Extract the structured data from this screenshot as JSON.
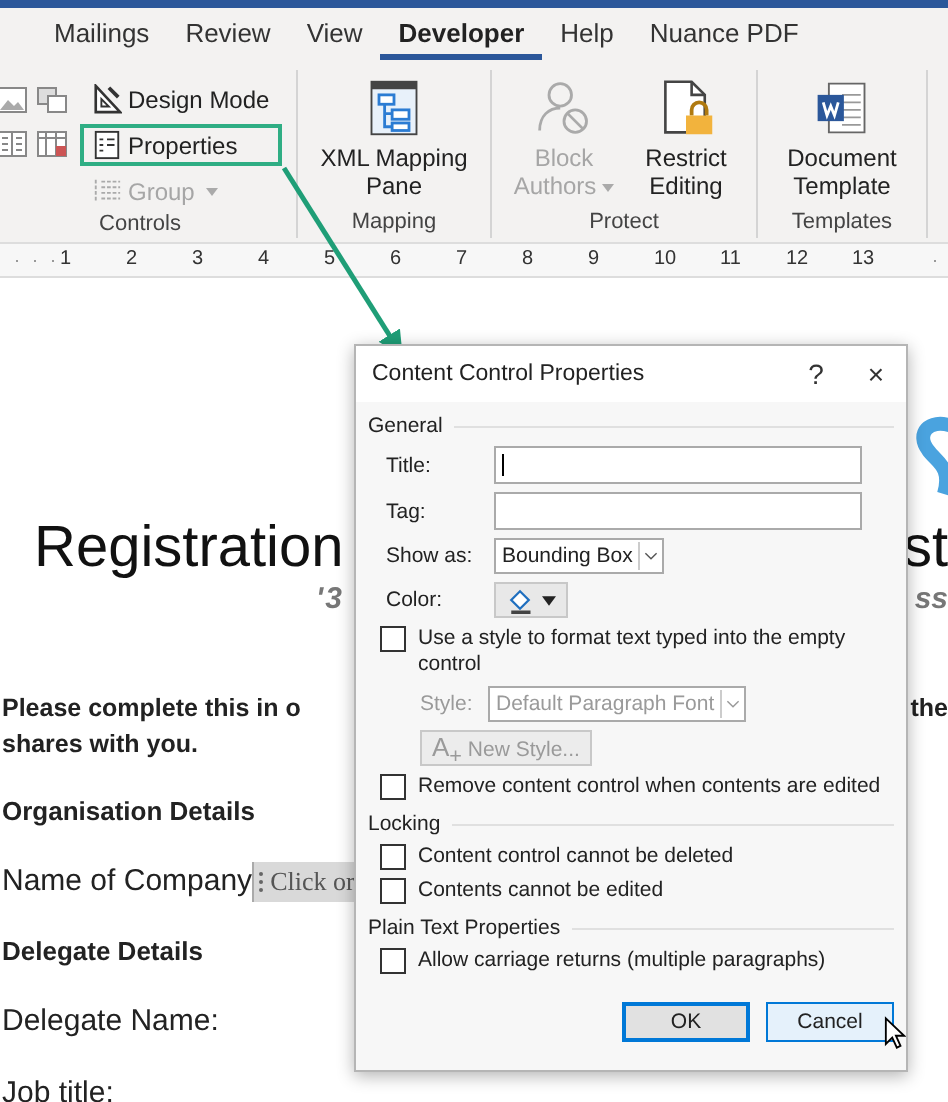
{
  "ribbon": {
    "tabs": [
      {
        "label": "Mailings",
        "selected": false
      },
      {
        "label": "Review",
        "selected": false
      },
      {
        "label": "View",
        "selected": false
      },
      {
        "label": "Developer",
        "selected": true
      },
      {
        "label": "Help",
        "selected": false
      },
      {
        "label": "Nuance PDF",
        "selected": false
      }
    ],
    "controls_group": {
      "label": "Controls",
      "commands": [
        {
          "kind": "design",
          "label": "Design Mode",
          "disabled": false,
          "highlighted": false,
          "dropdown": false
        },
        {
          "kind": "properties",
          "label": "Properties",
          "disabled": false,
          "highlighted": true,
          "dropdown": false
        },
        {
          "kind": "group",
          "label": "Group",
          "disabled": true,
          "highlighted": false,
          "dropdown": true
        }
      ]
    },
    "groups": [
      {
        "label": "Mapping",
        "buttons": [
          {
            "kind": "tree-pane",
            "label": "XML Mapping Pane",
            "disabled": false,
            "dropdown": false
          }
        ]
      },
      {
        "label": "Protect",
        "buttons": [
          {
            "kind": "person-block",
            "label": "Block Authors",
            "disabled": true,
            "dropdown": true
          },
          {
            "kind": "document-lock",
            "label": "Restrict Editing",
            "disabled": false,
            "dropdown": false
          }
        ]
      },
      {
        "label": "Templates",
        "buttons": [
          {
            "kind": "word-document",
            "label": "Document Template",
            "disabled": false,
            "dropdown": false
          }
        ]
      }
    ]
  },
  "ruler_marks": [
    "1",
    "2",
    "3",
    "4",
    "5",
    "6",
    "7",
    "8",
    "9",
    "10",
    "11",
    "12",
    "13"
  ],
  "document": {
    "title_left": "Registration",
    "title_right": "st",
    "subtitle_left": "'3",
    "subtitle_right": "ss",
    "intro_left": "Please complete this in o",
    "intro_right": "the",
    "intro_line2": "shares with you.",
    "paragraphs": [
      {
        "kind": "heading",
        "text": "Organisation Details"
      },
      {
        "kind": "field",
        "text": "Name of Company",
        "control_text": "Click or"
      },
      {
        "kind": "heading",
        "text": "Delegate Details"
      },
      {
        "kind": "label",
        "text": "Delegate Name:"
      },
      {
        "kind": "label",
        "text": "Job title:"
      }
    ]
  },
  "dialog": {
    "title": "Content Control Properties",
    "help": "?",
    "close": "×",
    "general": {
      "label": "General",
      "title_label": "Title:",
      "title_focused": true,
      "tag_label": "Tag:",
      "show_as_label": "Show as:",
      "show_as_value": "Bounding Box",
      "color_label": "Color:",
      "use_style": {
        "label": "Use a style to format text typed into the empty control",
        "checked": false
      },
      "style_label": "Style:",
      "style_value": "Default Paragraph Font",
      "style_disabled": true,
      "new_style_glyph": "A$_{+}$",
      "new_style": "New Style...",
      "remove": {
        "label": "Remove content control when contents are edited",
        "checked": false
      }
    },
    "locking": {
      "label": "Locking",
      "options": [
        {
          "label": "Content control cannot be deleted",
          "checked": false
        },
        {
          "label": "Contents cannot be edited",
          "checked": false
        }
      ]
    },
    "plain_text": {
      "label": "Plain Text Properties",
      "options": [
        {
          "label": "Allow carriage returns (multiple paragraphs)",
          "checked": false
        }
      ]
    },
    "buttons": [
      {
        "label": "OK",
        "default": true,
        "hovered": false
      },
      {
        "label": "Cancel",
        "default": false,
        "hovered": true
      }
    ]
  }
}
